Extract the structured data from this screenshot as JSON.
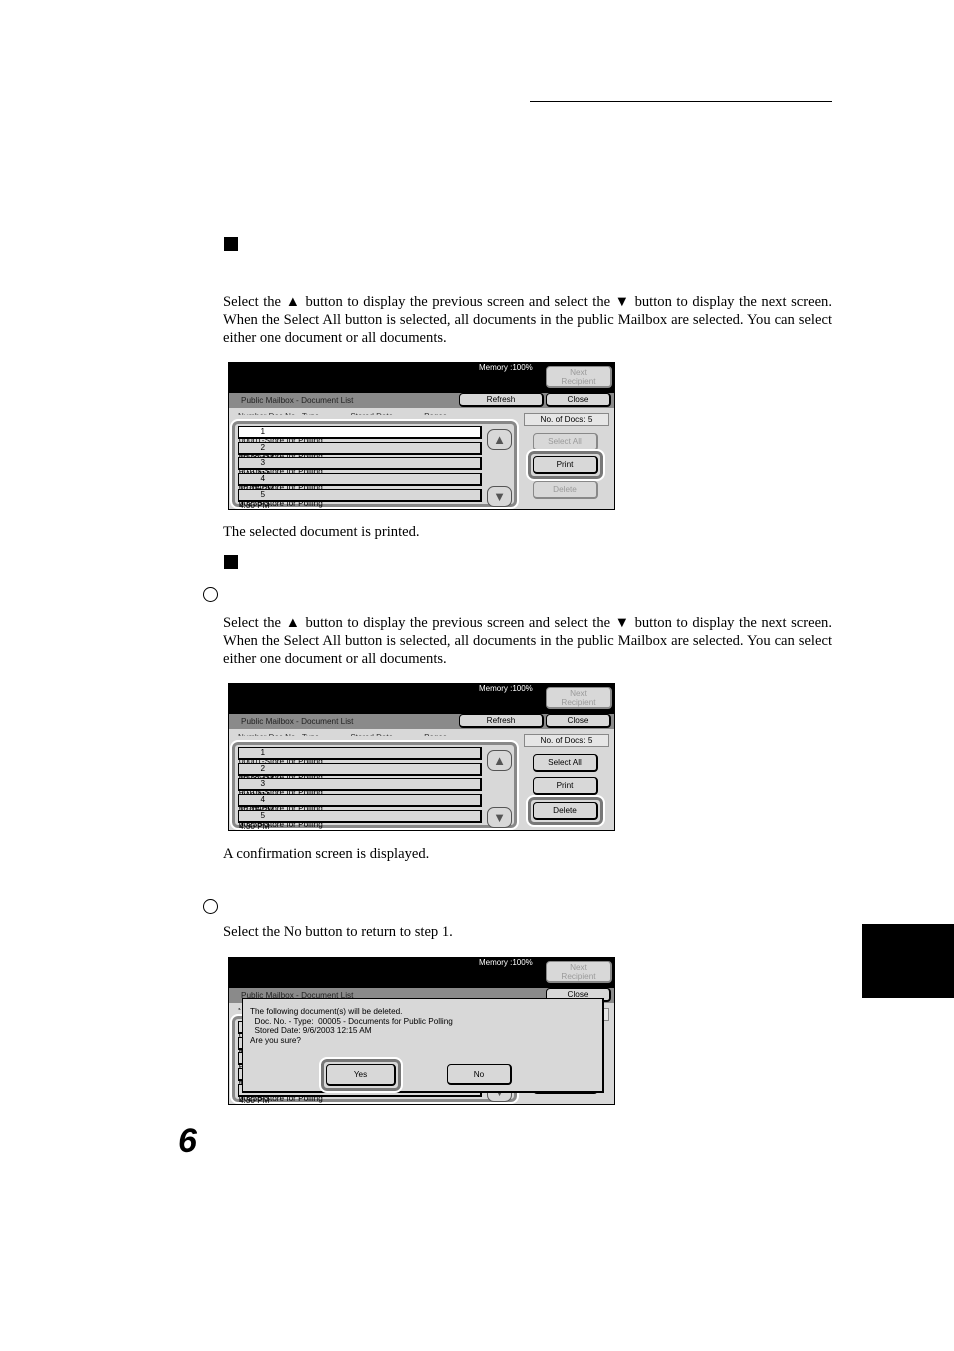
{
  "para_select": "Select the ▲ button to display the previous screen and select the ▼ button to display the next screen. When the Select All button is selected, all documents in the public Mailbox are selected. You can select either one document or all documents.",
  "text_printed": "The selected document is printed.",
  "text_confirmation": "A confirmation screen is displayed.",
  "text_no": "Select the No button to return to step 1.",
  "page_number": "6",
  "screen": {
    "memory": "Memory :100%",
    "next_recipient": "Next\nRecipient",
    "title": "Public Mailbox - Document List",
    "refresh": "Refresh",
    "close": "Close",
    "columns": "Number Doc No.  Type              Stored Date              Pages",
    "no_of_docs": "No. of Docs: 5",
    "select_all": "Select All",
    "print": "Print",
    "delete": "Delete",
    "up_icon": "up-arrow-icon",
    "down_icon": "down-arrow-icon",
    "rows": [
      {
        "num": "1",
        "doc": "00001-Store for Polling",
        "date": "2001/8/21",
        "time": "10:20 AM",
        "pages": "5"
      },
      {
        "num": "2",
        "doc": "00025-Store for Polling",
        "date": "2001/8/26",
        "time": "8:10 AM",
        "pages": "1"
      },
      {
        "num": "3",
        "doc": "00105-Store for Polling",
        "date": "2001/8/31",
        "time": "12:15 PM",
        "pages": "1"
      },
      {
        "num": "4",
        "doc": "00164-Store for Polling",
        "date": "2001/9/15",
        "time": "4:30 PM",
        "pages": "15"
      },
      {
        "num": "5",
        "doc": "00236-Store for Polling",
        "date": "2001/9/28",
        "time": "8:30 AM",
        "pages": "39"
      }
    ]
  },
  "dialog": {
    "lines": [
      "The following document(s) will be deleted.",
      "  Doc. No. - Type:  00005 - Documents for Public Polling",
      "  Stored Date: 9/6/2003 12:15 AM",
      "Are you sure?"
    ],
    "yes": "Yes",
    "no": "No"
  }
}
